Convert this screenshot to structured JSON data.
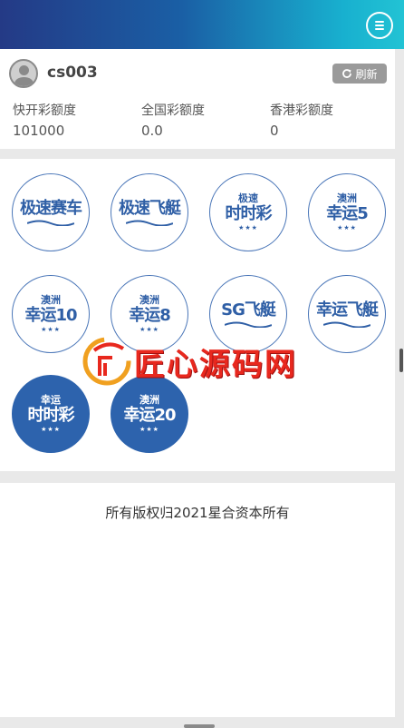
{
  "header": {
    "menu_icon": "hamburger-icon"
  },
  "user": {
    "name": "cs003",
    "refresh_label": "刷新",
    "refresh_icon": "refresh-icon"
  },
  "quotas": [
    {
      "label": "快开彩额度",
      "value": "101000"
    },
    {
      "label": "全国彩额度",
      "value": "0.0"
    },
    {
      "label": "香港彩额度",
      "value": "0"
    }
  ],
  "games": [
    {
      "sub": "",
      "main": "极速赛车",
      "filled": false
    },
    {
      "sub": "",
      "main": "极速飞艇",
      "filled": false
    },
    {
      "sub": "极速",
      "main": "时时彩",
      "filled": false
    },
    {
      "sub": "澳洲",
      "main": "幸运5",
      "filled": false
    },
    {
      "sub": "澳洲",
      "main": "幸运10",
      "filled": false
    },
    {
      "sub": "澳洲",
      "main": "幸运8",
      "filled": false
    },
    {
      "sub": "",
      "main": "SG飞艇",
      "filled": false
    },
    {
      "sub": "",
      "main": "幸运飞艇",
      "filled": false
    },
    {
      "sub": "幸运",
      "main": "时时彩",
      "filled": true
    },
    {
      "sub": "澳洲",
      "main": "幸运20",
      "filled": true
    }
  ],
  "watermark": {
    "text": "匠心源码网"
  },
  "footer": {
    "copyright": "所有版权归2021星合资本所有"
  },
  "colors": {
    "header_start": "#243a86",
    "header_end": "#22c3d4",
    "badge_blue": "#2f5fa6",
    "watermark_red": "#e8281e"
  }
}
